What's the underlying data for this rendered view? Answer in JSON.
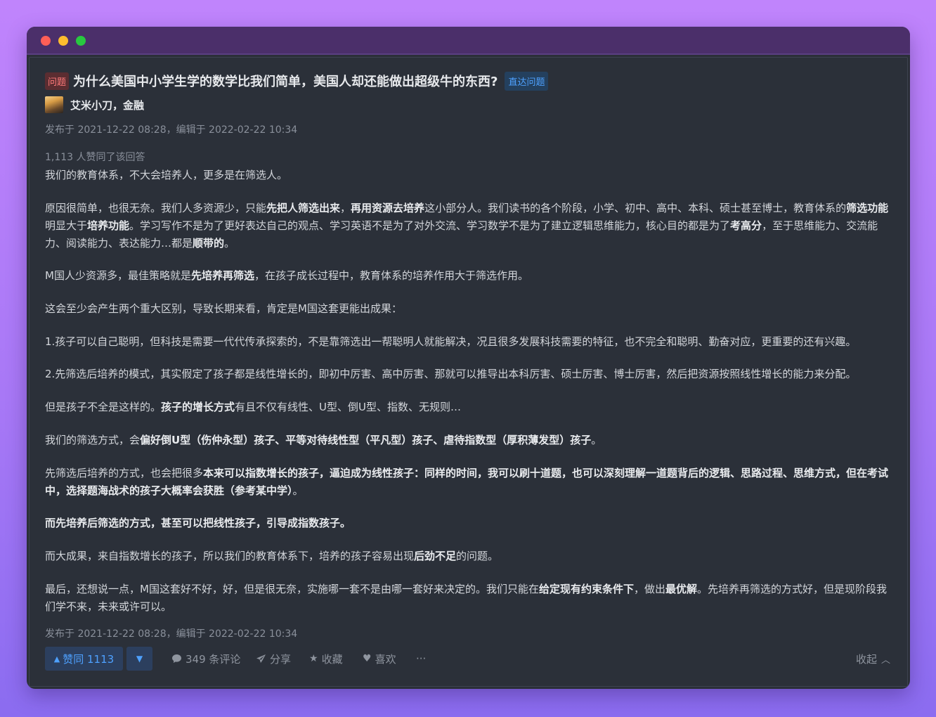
{
  "window": {
    "controls": [
      "close",
      "minimize",
      "maximize"
    ]
  },
  "question": {
    "tag": "问题",
    "title": "为什么美国中小学生学的数学比我们简单，美国人却还能做出超级牛的东西?",
    "link_label": "直达问题"
  },
  "author": {
    "name": "艾米小刀，金融",
    "avatar": "sunset-avatar"
  },
  "meta": {
    "published": "发布于 2021-12-22 08:28，编辑于 2022-02-22 10:34",
    "likes_text": "1,113 人赞同了该回答",
    "published_bottom": "发布于 2021-12-22 08:28，编辑于 2022-02-22 10:34"
  },
  "paragraphs": [
    [
      {
        "t": "我们的教育体系，不大会培养人，更多是在筛选人。"
      }
    ],
    [
      {
        "t": "原因很简单，也很无奈。我们人多资源少，只能"
      },
      {
        "t": "先把人筛选出来",
        "b": true
      },
      {
        "t": "，"
      },
      {
        "t": "再用资源去培养",
        "b": true
      },
      {
        "t": "这小部分人。我们读书的各个阶段，小学、初中、高中、本科、硕士甚至博士，教育体系的"
      },
      {
        "t": "筛选功能",
        "b": true
      },
      {
        "t": "明显大于"
      },
      {
        "t": "培养功能",
        "b": true
      },
      {
        "t": "。学习写作不是为了更好表达自己的观点、学习英语不是为了对外交流、学习数学不是为了建立逻辑思维能力，核心目的都是为了"
      },
      {
        "t": "考高分",
        "b": true
      },
      {
        "t": "，至于思维能力、交流能力、阅读能力、表达能力…都是"
      },
      {
        "t": "顺带的",
        "b": true
      },
      {
        "t": "。"
      }
    ],
    [
      {
        "t": "M国人少资源多，最佳策略就是"
      },
      {
        "t": "先培养再筛选",
        "b": true
      },
      {
        "t": "，在孩子成长过程中，教育体系的培养作用大于筛选作用。"
      }
    ],
    [
      {
        "t": "这会至少会产生两个重大区别，导致长期来看，肯定是M国这套更能出成果："
      }
    ],
    [
      {
        "t": "1.孩子可以自己聪明，但科技是需要一代代传承探索的，不是靠筛选出一帮聪明人就能解决，况且很多发展科技需要的特征，也不完全和聪明、勤奋对应，更重要的还有兴趣。"
      }
    ],
    [
      {
        "t": "2.先筛选后培养的模式，其实假定了孩子都是线性增长的，即初中厉害、高中厉害、那就可以推导出本科厉害、硕士厉害、博士厉害，然后把资源按照线性增长的能力来分配。"
      }
    ],
    [
      {
        "t": "但是孩子不全是这样的。"
      },
      {
        "t": "孩子的增长方式",
        "b": true
      },
      {
        "t": "有且不仅有线性、U型、倒U型、指数、无规则…"
      }
    ],
    [
      {
        "t": "我们的筛选方式，会"
      },
      {
        "t": "偏好倒U型（伤仲永型）孩子、平等对待线性型（平凡型）孩子、虐待指数型（厚积薄发型）孩子",
        "b": true
      },
      {
        "t": "。"
      }
    ],
    [
      {
        "t": "先筛选后培养的方式，也会把很多"
      },
      {
        "t": "本来可以指数增长的孩子，逼迫成为线性孩子：同样的时间，我可以刷十道题，也可以深刻理解一道题背后的逻辑、思路过程、思维方式，但在考试中，选择题海战术的孩子大概率会获胜（参考某中学）",
        "b": true
      },
      {
        "t": "。"
      }
    ],
    [
      {
        "t": "而先培养后筛选的方式，甚至可以把线性孩子，引导成指数孩子。",
        "b": true
      }
    ],
    [
      {
        "t": "而大成果，来自指数增长的孩子，所以我们的教育体系下，培养的孩子容易出现"
      },
      {
        "t": "后劲不足",
        "b": true
      },
      {
        "t": "的问题。"
      }
    ],
    [
      {
        "t": "最后，还想说一点，M国这套好不好，好，但是很无奈，实施哪一套不是由哪一套好来决定的。我们只能在"
      },
      {
        "t": "给定现有约束条件下",
        "b": true
      },
      {
        "t": "，做出"
      },
      {
        "t": "最优解",
        "b": true
      },
      {
        "t": "。先培养再筛选的方式好，但是现阶段我们学不来，未来或许可以。"
      }
    ]
  ],
  "actions": {
    "upvote_label": "赞同 1113",
    "comments_label": "349 条评论",
    "share_label": "分享",
    "favorite_label": "收藏",
    "like_label": "喜欢",
    "more_label": "···",
    "collapse_label": "收起"
  },
  "icons": {
    "upvote": "▲",
    "downvote": "▼",
    "comment": "💬",
    "share": "➤",
    "star": "★",
    "heart": "♥",
    "chevron_up": "︿"
  },
  "colors": {
    "accent": "#4ea1ff",
    "tag_red": "#ff7a7a",
    "bg": "#2b3039",
    "titlebar": "#4b2f6a"
  }
}
